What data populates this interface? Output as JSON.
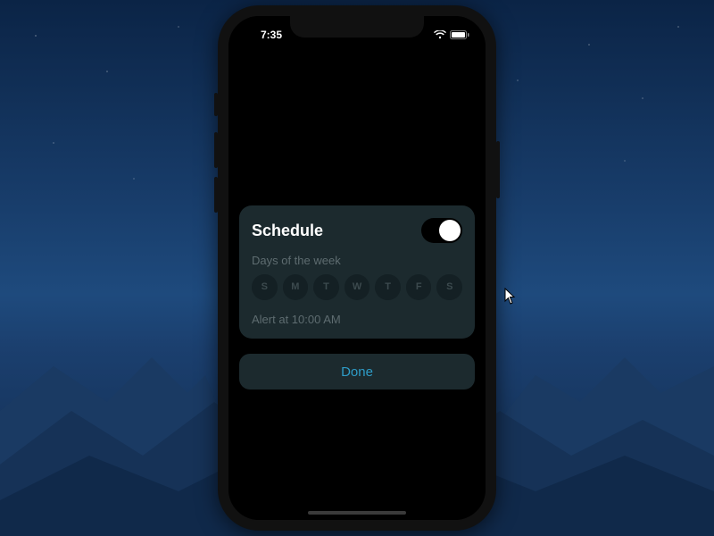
{
  "statusbar": {
    "time": "7:35"
  },
  "card": {
    "title": "Schedule",
    "schedule_enabled": true,
    "days_label": "Days of the week",
    "days": [
      "S",
      "M",
      "T",
      "W",
      "T",
      "F",
      "S"
    ],
    "alert_text": "Alert at 10:00 AM"
  },
  "done_button": {
    "label": "Done"
  },
  "colors": {
    "card_bg": "#1c2a2e",
    "accent": "#2e9bc6",
    "muted_text": "#5e6c70"
  }
}
